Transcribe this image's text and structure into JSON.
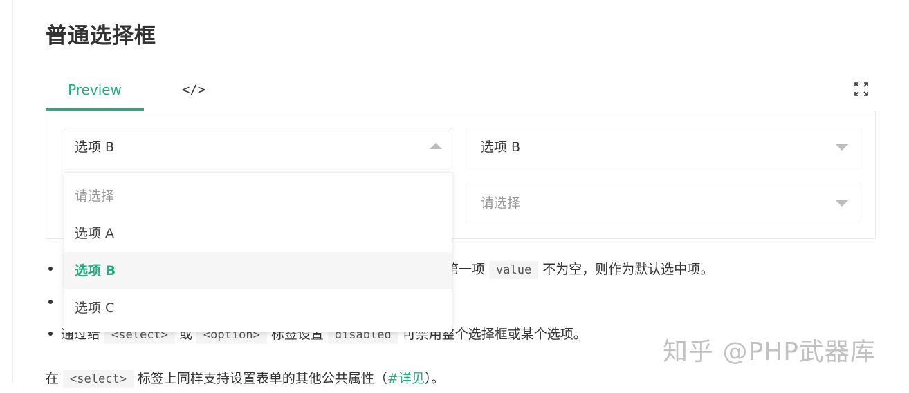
{
  "page": {
    "title": "普通选择框"
  },
  "tabs": {
    "preview": "Preview",
    "code": "</>"
  },
  "selects": {
    "s1": {
      "value": "选项 B"
    },
    "s2": {
      "value": "选项 B"
    },
    "s4": {
      "placeholder": "请选择"
    }
  },
  "dropdown": {
    "items": [
      {
        "label": "请选择"
      },
      {
        "label": "选项 A"
      },
      {
        "label": "选项 B"
      },
      {
        "label": "选项 C"
      }
    ]
  },
  "bullets": {
    "b1": {
      "text_before": "第一项",
      "code": "value",
      "text_after": "不为空，则作为默认选中项。"
    },
    "b2": {},
    "b3": {
      "text_before": "通过给",
      "code1": "<select>",
      "text_mid1": "或",
      "code2": "<option>",
      "text_mid2": "标签设置",
      "code3": "disabled",
      "text_after": "可禁用整个选择框或某个选项。"
    }
  },
  "paragraph": {
    "text_before": "在",
    "code": "<select>",
    "text_mid": "标签上同样支持设置表单的其他公共属性（",
    "link": "#详见",
    "text_after": "）。"
  },
  "watermark": "知乎 @PHP武器库",
  "colors": {
    "accent": "#24ad82",
    "border": "#e3e3e3"
  }
}
